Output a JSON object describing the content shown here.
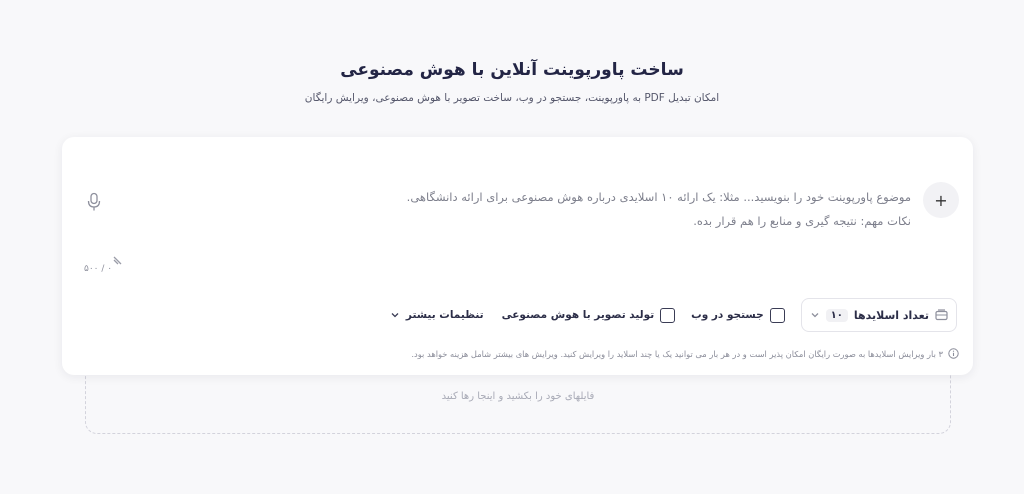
{
  "header": {
    "title": "ساخت پاورپوینت آنلاین با هوش مصنوعی",
    "subtitle": "امکان تبدیل PDF به پاورپوینت، جستجو در وب، ساخت تصویر با هوش مصنوعی، ویرایش رایگان"
  },
  "prompt": {
    "line1": "موضوع پاورپوینت خود را بنویسید... مثلا: یک ارائه ۱۰ اسلایدی درباره هوش مصنوعی برای ارائه دانشگاهی.",
    "line2": "نکات مهم: نتیجه گیری و منابع را هم قرار بده.",
    "counter": "۰ / ۵۰۰"
  },
  "controls": {
    "slides_label": "تعداد اسلایدها",
    "slides_value": "۱۰",
    "web_search_label": "جستجو در وب",
    "ai_image_label": "تولید تصویر با هوش مصنوعی",
    "more_settings_label": "تنظیمات بیشتر"
  },
  "footnote": {
    "text": "۳ بار ویرایش اسلایدها به صورت رایگان امکان پذیر است و در هر بار می توانید یک یا چند اسلاید را ویرایش کنید. ویرایش های بیشتر شامل هزینه خواهد بود."
  },
  "dropzone": {
    "text": "فایلهای خود را بکشید و اینجا رها کنید"
  },
  "icons": {
    "plus": "+",
    "mic": "microphone-icon",
    "chevron": "chevron-down-icon",
    "slides": "slides-icon",
    "info": "info-icon",
    "wave": "signal-icon"
  }
}
